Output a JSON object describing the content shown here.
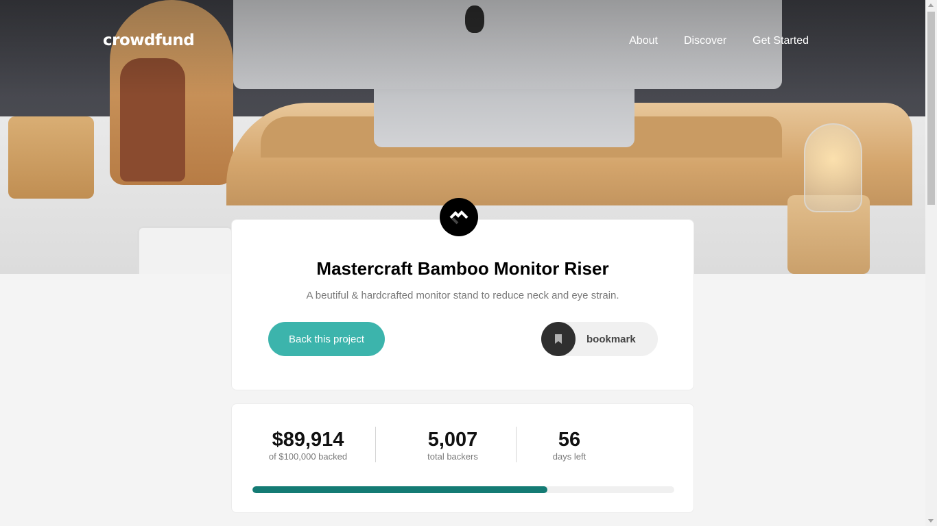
{
  "brand": {
    "logo": "crowdfund"
  },
  "nav": {
    "items": [
      {
        "label": "About"
      },
      {
        "label": "Discover"
      },
      {
        "label": "Get Started"
      }
    ]
  },
  "project": {
    "title": "Mastercraft Bamboo Monitor Riser",
    "description": "A beutiful & hardcrafted monitor stand to reduce neck and eye strain.",
    "back_button": "Back this project",
    "bookmark_label": "bookmark"
  },
  "stats": {
    "backed_amount": "$89,914",
    "backed_label": "of $100,000 backed",
    "backers": "5,007",
    "backers_label": "total backers",
    "days": "56",
    "days_label": "days left",
    "progress_fraction": 0.69914
  },
  "colors": {
    "accent": "#3cb4ac",
    "accent_dark": "#147b74",
    "badge_bg": "#000000",
    "bookmark_circle": "#2f2f2f"
  },
  "icons": {
    "badge": "mastercraft-logo-icon",
    "bookmark": "bookmark-icon"
  }
}
